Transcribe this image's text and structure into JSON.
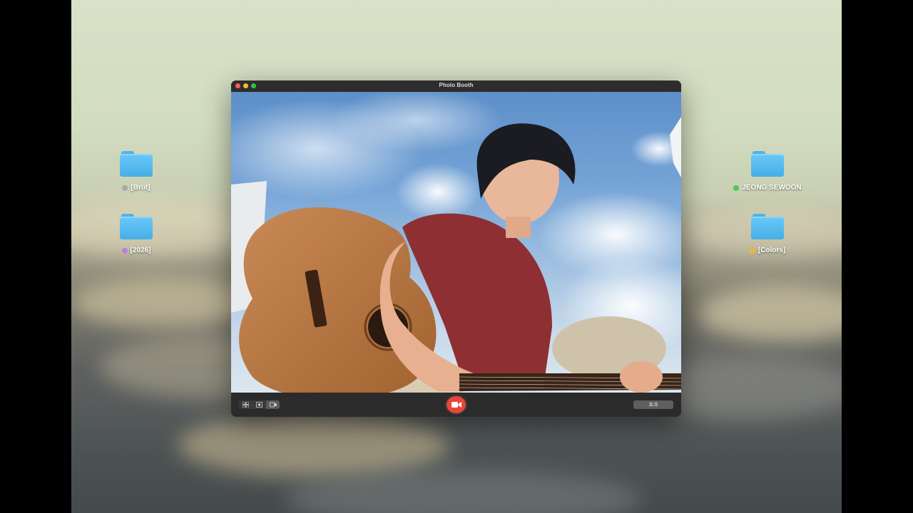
{
  "window": {
    "title": "Photo Booth",
    "traffic_lights": {
      "close": "#ff5f57",
      "minimize": "#febc2e",
      "zoom": "#28c840"
    }
  },
  "desktop": {
    "folders": [
      {
        "label": "[Brut]",
        "tag_color": "#a9a9a9"
      },
      {
        "label": "[2026]",
        "tag_color": "#c17de0"
      },
      {
        "label": "JEONG SEWOON",
        "tag_color": "#3fcf5a"
      },
      {
        "label": "[Colors]",
        "tag_color": "#f2b33a"
      }
    ]
  },
  "toolbar": {
    "view_buttons": [
      "grid-view-icon",
      "single-photo-icon",
      "video-icon"
    ],
    "active_view": "video-icon",
    "capture_icon": "video-camera-icon",
    "capture_color": "#e8453c",
    "effects_label": "효과"
  },
  "camera": {
    "scene": "live-camera-feed"
  }
}
